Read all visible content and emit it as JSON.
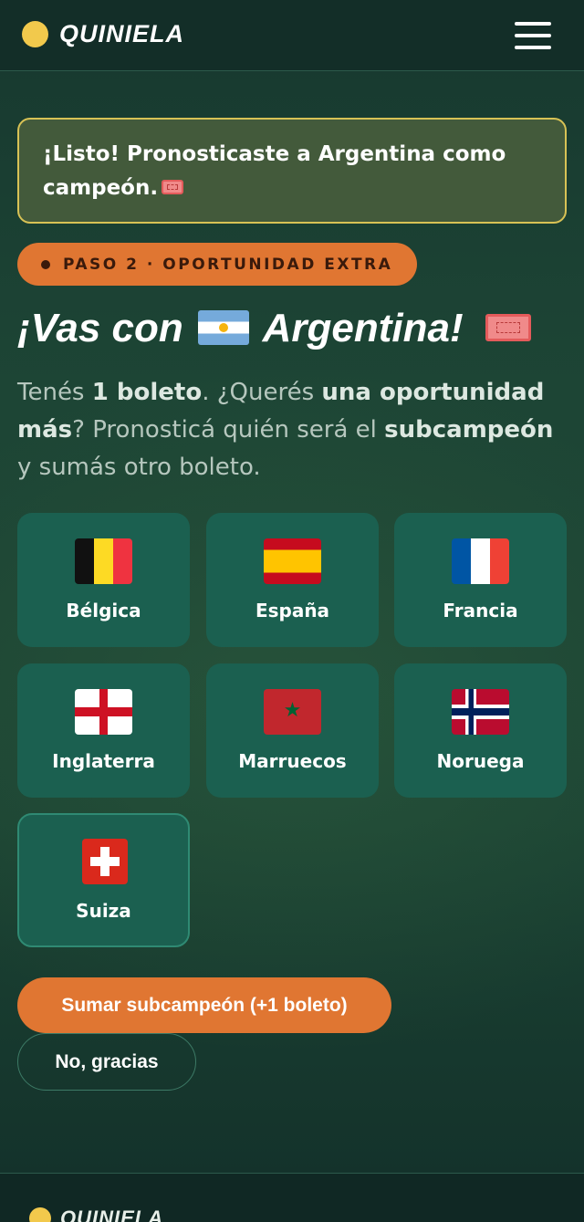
{
  "header": {
    "brand": "QUINIELA"
  },
  "notice": {
    "text": "¡Listo! Pronosticaste a Argentina como campeón."
  },
  "step": {
    "label": "PASO 2 · OPORTUNIDAD EXTRA"
  },
  "headline": {
    "prefix": "¡Vas con",
    "team": "Argentina!"
  },
  "description": {
    "p1": "Tenés ",
    "b1": "1 boleto",
    "p2": ". ¿Querés ",
    "b2": "una oportunidad más",
    "p3": "? Pronosticá quién será el ",
    "b3": "subcampeón",
    "p4": " y sumás otro boleto."
  },
  "teams": [
    {
      "name": "Bélgica",
      "flag": "belgium-flag"
    },
    {
      "name": "España",
      "flag": "spain-flag"
    },
    {
      "name": "Francia",
      "flag": "france-flag"
    },
    {
      "name": "Inglaterra",
      "flag": "england-flag"
    },
    {
      "name": "Marruecos",
      "flag": "morocco-flag"
    },
    {
      "name": "Noruega",
      "flag": "norway-flag"
    },
    {
      "name": "Suiza",
      "flag": "switzerland-flag"
    }
  ],
  "actions": {
    "primary": "Sumar subcampeón (+1 boleto)",
    "secondary": "No, gracias"
  },
  "footer": {
    "brand": "QUINIELA"
  }
}
